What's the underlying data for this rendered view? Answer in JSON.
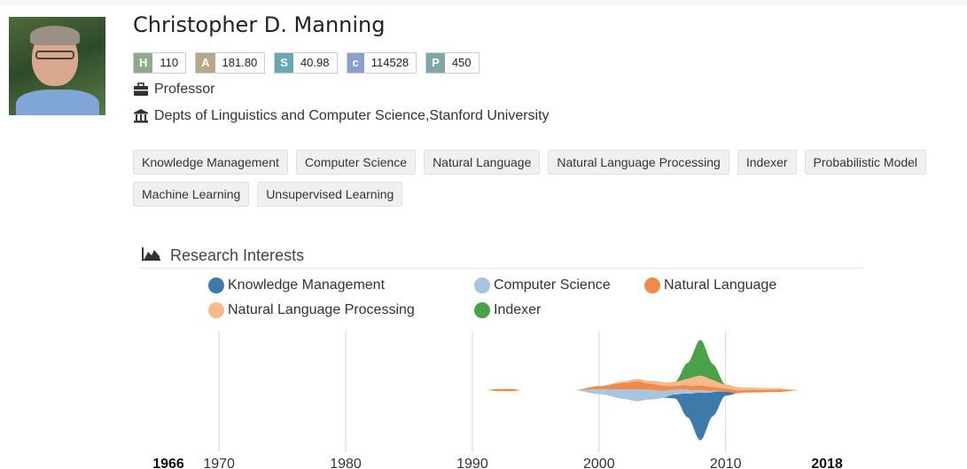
{
  "profile": {
    "name": "Christopher D. Manning",
    "metrics": [
      {
        "key": "H",
        "value": "110",
        "color": "#8faa8a"
      },
      {
        "key": "A",
        "value": "181.80",
        "color": "#b8a88a"
      },
      {
        "key": "S",
        "value": "40.98",
        "color": "#6aa7b0"
      },
      {
        "key": "c",
        "value": "114528",
        "color": "#8a9fcc"
      },
      {
        "key": "P",
        "value": "450",
        "color": "#7fa7a8"
      }
    ],
    "position": "Professor",
    "affiliation": "Depts of Linguistics and Computer Science,Stanford University",
    "position_icon": "briefcase-icon",
    "affiliation_icon": "institution-icon"
  },
  "tags": [
    "Knowledge Management",
    "Computer Science",
    "Natural Language",
    "Natural Language Processing",
    "Indexer",
    "Probabilistic Model",
    "Machine Learning",
    "Unsupervised Learning"
  ],
  "research": {
    "title": "Research Interests",
    "icon": "area-chart-icon"
  },
  "chart_data": {
    "type": "area",
    "subtype": "streamgraph",
    "x_range": [
      1966,
      2018
    ],
    "ticks": [
      "1966",
      "1970",
      "1980",
      "1990",
      "2000",
      "2010",
      "2018"
    ],
    "series": [
      {
        "name": "Knowledge Management",
        "color": "#3d7aaa",
        "x": [
          2005,
          2006,
          2007,
          2008,
          2009,
          2010,
          2011
        ],
        "values": [
          0,
          0.5,
          3,
          6,
          3,
          0.5,
          0
        ]
      },
      {
        "name": "Computer Science",
        "color": "#a7c4e0",
        "x": [
          1998,
          2000,
          2002,
          2003,
          2004,
          2006,
          2008,
          2010
        ],
        "values": [
          0,
          0.6,
          1.2,
          1.5,
          1.2,
          0.6,
          0.3,
          0
        ]
      },
      {
        "name": "Natural Language",
        "color": "#f08a4b",
        "x": [
          1991,
          1992,
          1993,
          1994,
          1998,
          2000,
          2002,
          2003,
          2004,
          2006,
          2008,
          2010,
          2012,
          2014,
          2016
        ],
        "values": [
          0,
          0.25,
          0.3,
          0,
          0,
          0.4,
          0.8,
          1,
          0.8,
          0.5,
          0.6,
          0.4,
          0.3,
          0.3,
          0
        ]
      },
      {
        "name": "Natural Language Processing",
        "color": "#f7b98c",
        "x": [
          2000,
          2003,
          2006,
          2008,
          2010,
          2012,
          2014,
          2016
        ],
        "values": [
          0,
          0.3,
          0.5,
          1.2,
          0.5,
          0.3,
          0.2,
          0
        ]
      },
      {
        "name": "Indexer",
        "color": "#4aa14a",
        "x": [
          2006,
          2007,
          2008,
          2009,
          2010
        ],
        "values": [
          0,
          2,
          4.5,
          2,
          0
        ]
      }
    ]
  }
}
